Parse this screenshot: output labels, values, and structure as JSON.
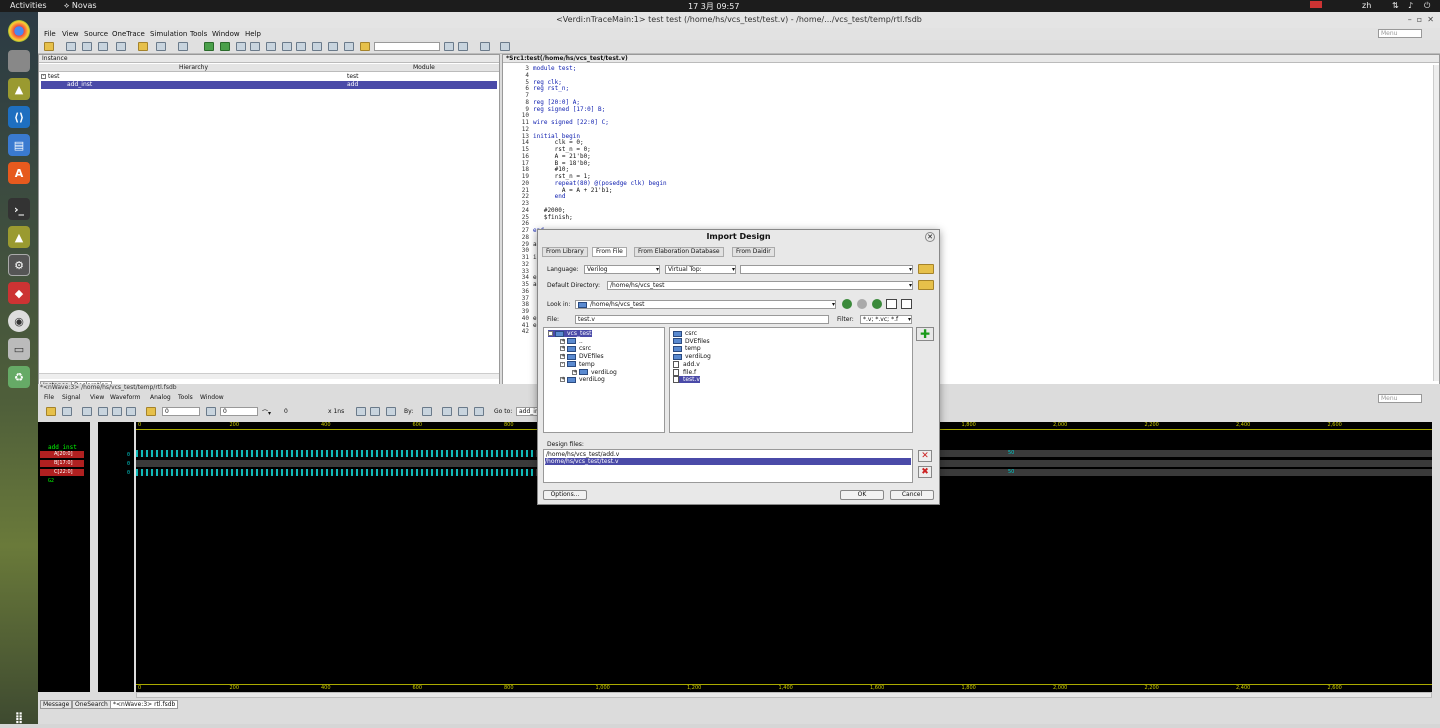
{
  "topbar": {
    "activities": "Activities",
    "app": "Novas",
    "clock": "17 3月 09:57",
    "lang": "zh"
  },
  "window": {
    "title": "<Verdi:nTraceMain:1> test test (/home/hs/vcs_test/test.v) - /home/.../vcs_test/temp/rtl.fsdb",
    "menu": [
      "File",
      "View",
      "Source",
      "OneTrace",
      "Simulation",
      "Tools",
      "Window",
      "Help"
    ],
    "menu_search": "Menu"
  },
  "instance": {
    "label": "Instance",
    "col_hier": "Hierarchy",
    "col_module": "Module",
    "rows": [
      {
        "name": "test",
        "module": "test"
      },
      {
        "name": "add_inst",
        "module": "add"
      }
    ],
    "tabs": [
      "Instance",
      "Declaration"
    ]
  },
  "source": {
    "title": "*Src1:test(/home/hs/vcs_test/test.v)",
    "lines": [
      {
        "n": "3",
        "t": "module test;"
      },
      {
        "n": "4",
        "t": ""
      },
      {
        "n": "5",
        "t": "reg clk;"
      },
      {
        "n": "6",
        "t": "reg rst_n;"
      },
      {
        "n": "7",
        "t": ""
      },
      {
        "n": "8",
        "t": "reg [20:0] A;"
      },
      {
        "n": "9",
        "t": "reg signed [17:0] B;"
      },
      {
        "n": "10",
        "t": ""
      },
      {
        "n": "11",
        "t": "wire signed [22:0] C;"
      },
      {
        "n": "12",
        "t": ""
      },
      {
        "n": "13",
        "t": "initial begin"
      },
      {
        "n": "14",
        "t": "      clk = 0;"
      },
      {
        "n": "15",
        "t": "      rst_n = 0;"
      },
      {
        "n": "16",
        "t": "      A = 21'b0;"
      },
      {
        "n": "17",
        "t": "      B = 18'b0;"
      },
      {
        "n": "18",
        "t": "      #10;"
      },
      {
        "n": "19",
        "t": "      rst_n = 1;"
      },
      {
        "n": "20",
        "t": "      repeat(80) @(posedge clk) begin"
      },
      {
        "n": "21",
        "t": "        A = A + 21'b1;"
      },
      {
        "n": "22",
        "t": "      end"
      },
      {
        "n": "23",
        "t": ""
      },
      {
        "n": "24",
        "t": "   #2000;"
      },
      {
        "n": "25",
        "t": "   $finish;"
      },
      {
        "n": "26",
        "t": ""
      },
      {
        "n": "27",
        "t": "end"
      },
      {
        "n": "28",
        "t": ""
      },
      {
        "n": "29",
        "t": "a"
      },
      {
        "n": "30",
        "t": ""
      },
      {
        "n": "31",
        "t": "i"
      },
      {
        "n": "32",
        "t": ""
      },
      {
        "n": "33",
        "t": ""
      },
      {
        "n": "34",
        "t": "e"
      },
      {
        "n": "35",
        "t": "a"
      },
      {
        "n": "36",
        "t": ""
      },
      {
        "n": "37",
        "t": ""
      },
      {
        "n": "38",
        "t": ""
      },
      {
        "n": "39",
        "t": ""
      },
      {
        "n": "40",
        "t": "e"
      },
      {
        "n": "41",
        "t": "e"
      },
      {
        "n": "42",
        "t": ""
      }
    ]
  },
  "wave": {
    "title": "*<nWave:3> /home/hs/vcs_test/temp/rtl.fsdb",
    "menu": [
      "File",
      "Signal",
      "View",
      "Waveform",
      "Analog",
      "Tools",
      "Window"
    ],
    "menu_search": "Menu",
    "cursor": "0",
    "marker": "0",
    "delta": "0",
    "scale": "x 1ns",
    "by": "By:",
    "goto": "Go to:",
    "goto_val": "add_in",
    "group": "add_inst",
    "signals": [
      "A[20:0]",
      "B[17:0]",
      "C[22:0]"
    ],
    "sig_values": [
      "0",
      "0",
      "0"
    ],
    "g2": "G2",
    "ruler": [
      "0",
      "200",
      "400",
      "600",
      "800",
      "1,000",
      "1,200",
      "1,400",
      "1,600",
      "1,800",
      "2,000",
      "2,200",
      "2,400",
      "2,600"
    ],
    "hex_tail": "50"
  },
  "bottom_tabs": [
    "Message",
    "OneSearch",
    "*<nWave:3> rtl.fsdb"
  ],
  "dialog": {
    "title": "Import Design",
    "tabs": [
      "From Library",
      "From File",
      "From Elaboration Database",
      "From Daidir"
    ],
    "language_label": "Language:",
    "language": "Verilog",
    "vtop_label": "Virtual Top:",
    "vtop": "",
    "defdir_label": "Default Directory:",
    "defdir": "/home/hs/vcs_test",
    "lookin_label": "Look in:",
    "lookin": "/home/hs/vcs_test",
    "file_label": "File:",
    "file": "test.v",
    "filter_label": "Filter:",
    "filter": "*.v; *.vc; *.f",
    "tree": [
      {
        "name": "vcs_test",
        "lvl": 0,
        "exp": "-"
      },
      {
        "name": "..",
        "lvl": 1,
        "exp": "+"
      },
      {
        "name": "csrc",
        "lvl": 1,
        "exp": "+"
      },
      {
        "name": "DVEfiles",
        "lvl": 1,
        "exp": "+"
      },
      {
        "name": "temp",
        "lvl": 1,
        "exp": "-"
      },
      {
        "name": "verdiLog",
        "lvl": 2,
        "exp": "+"
      },
      {
        "name": "verdiLog",
        "lvl": 1,
        "exp": "+"
      }
    ],
    "files": [
      {
        "name": "csrc",
        "type": "dir"
      },
      {
        "name": "DVEfiles",
        "type": "dir"
      },
      {
        "name": "temp",
        "type": "dir"
      },
      {
        "name": "verdiLog",
        "type": "dir"
      },
      {
        "name": "add.v",
        "type": "file"
      },
      {
        "name": "file.f",
        "type": "file"
      },
      {
        "name": "test.v",
        "type": "file"
      }
    ],
    "design_label": "Design files:",
    "design_files": [
      "/home/hs/vcs_test/add.v",
      "/home/hs/vcs_test/test.v"
    ],
    "options": "Options...",
    "ok": "OK",
    "cancel": "Cancel"
  }
}
